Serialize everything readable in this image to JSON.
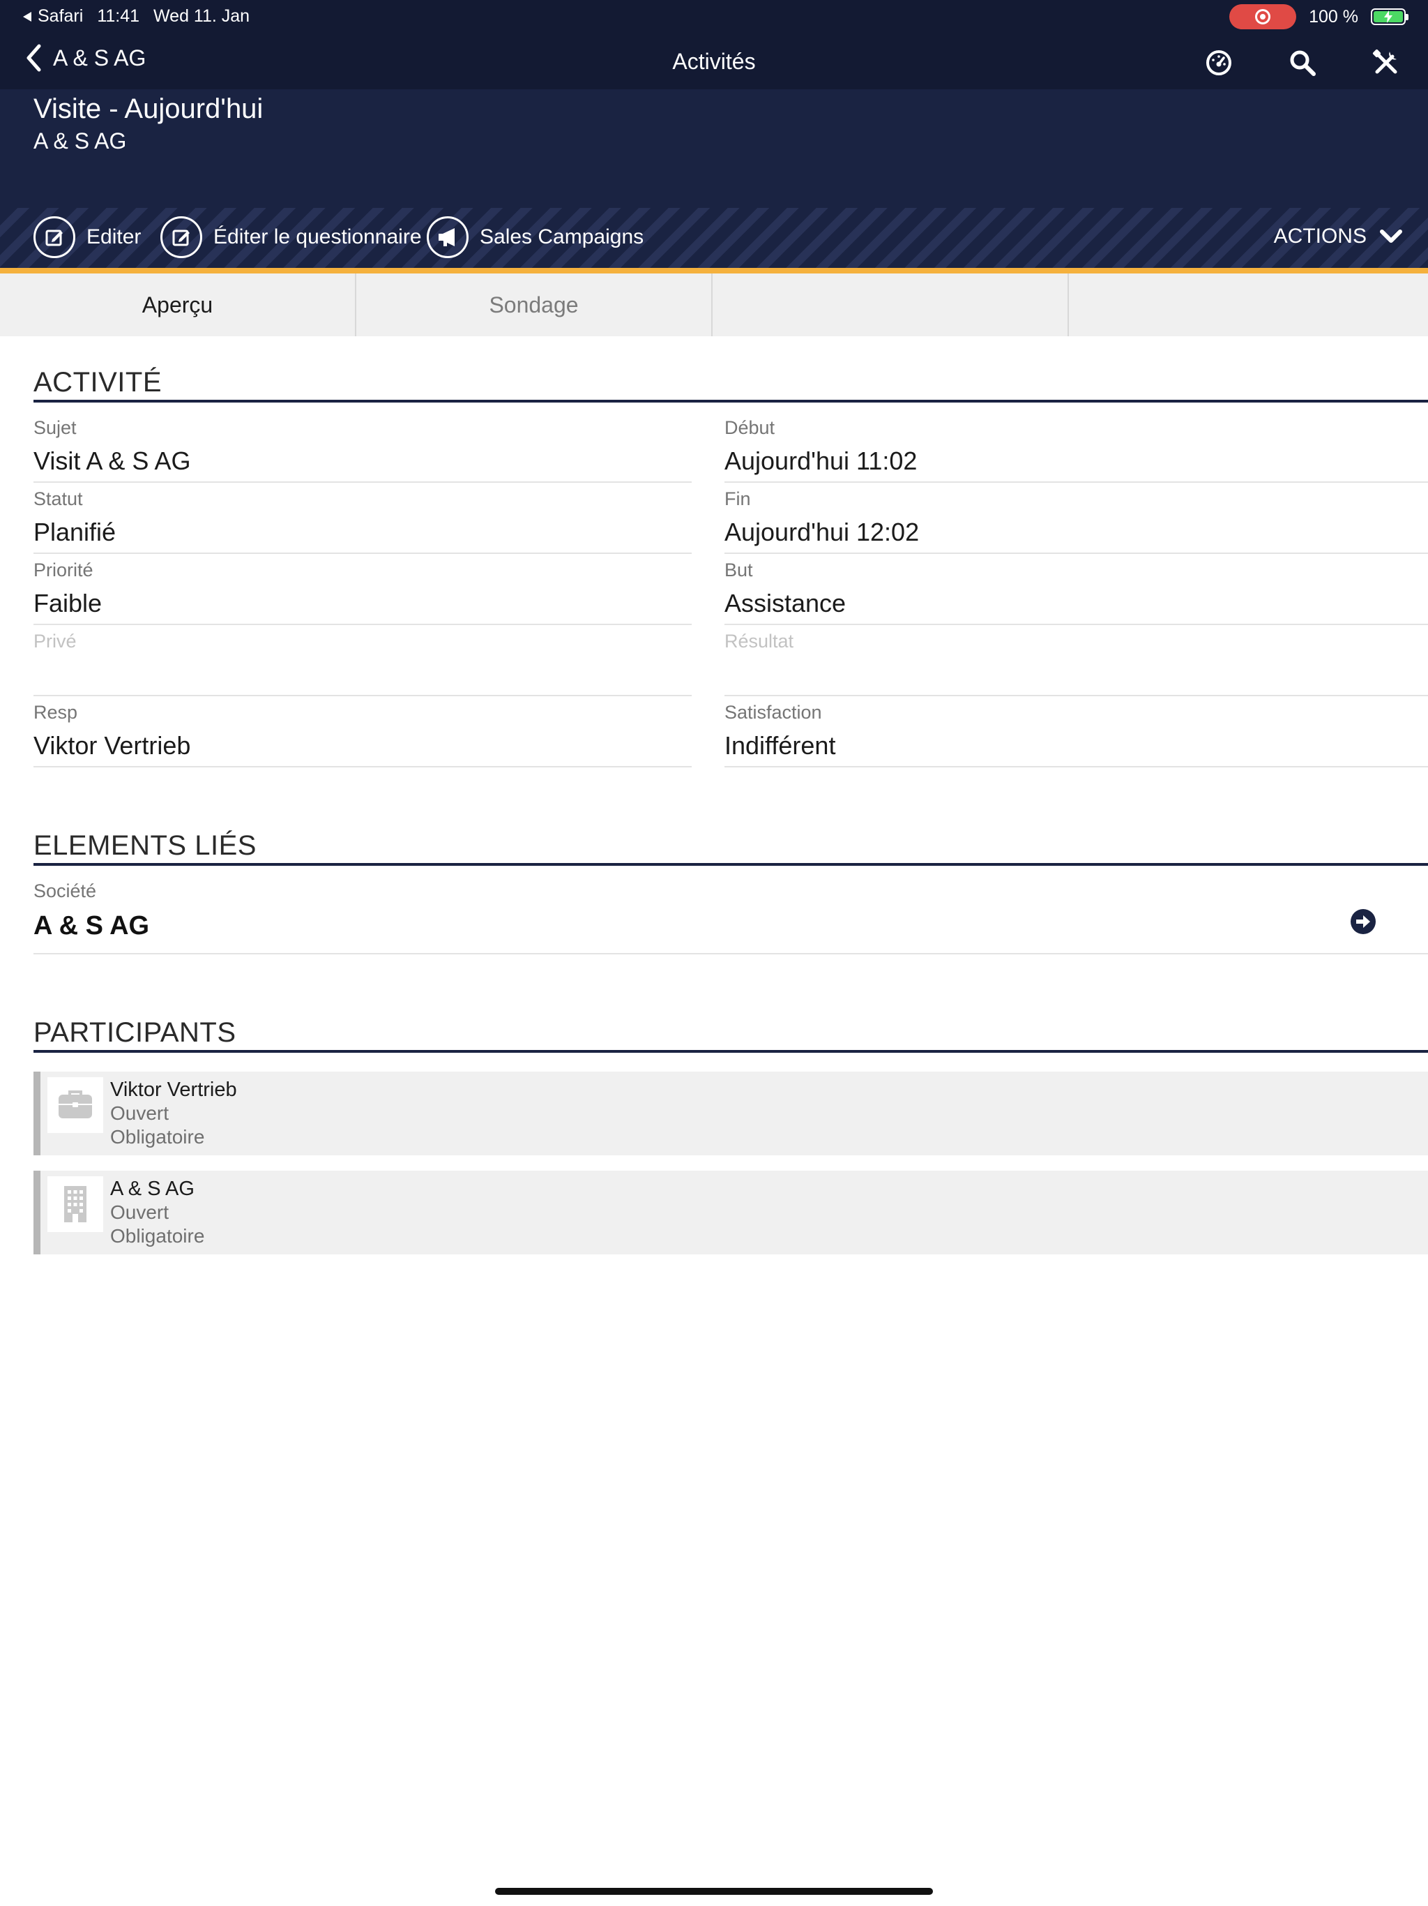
{
  "status_bar": {
    "back_app": "Safari",
    "time": "11:41",
    "date": "Wed 11. Jan",
    "battery": "100 %",
    "battery_level": 1.0
  },
  "nav": {
    "back_label": "A & S AG",
    "title": "Activités",
    "icons": [
      "dashboard-icon",
      "search-icon",
      "tools-icon"
    ]
  },
  "header": {
    "title": "Visite - Aujourd'hui",
    "subtitle": "A & S AG"
  },
  "actions": {
    "items": [
      {
        "label": "Editer",
        "icon": "edit-icon"
      },
      {
        "label": "Éditer le questionnaire",
        "icon": "edit-icon"
      },
      {
        "label": "Sales Campaigns",
        "icon": "megaphone-icon"
      }
    ],
    "menu_label": "ACTIONS"
  },
  "colors": {
    "navy": "#1a2342",
    "accent": "#f5b13d",
    "record": "#e04a45",
    "battery": "#4cd964"
  },
  "tabs": [
    {
      "label": "Aperçu",
      "active": true
    },
    {
      "label": "Sondage",
      "active": false
    },
    {
      "label": "",
      "active": false
    }
  ],
  "activity": {
    "section_title": "ACTIVITÉ",
    "left": [
      {
        "label": "Sujet",
        "value": "Visit A & S AG"
      },
      {
        "label": "Statut",
        "value": "Planifié"
      },
      {
        "label": "Priorité",
        "value": "Faible"
      },
      {
        "label": "Privé",
        "value": ""
      },
      {
        "label": "Resp",
        "value": "Viktor Vertrieb"
      }
    ],
    "right": [
      {
        "label": "Début",
        "value": "Aujourd'hui 11:02"
      },
      {
        "label": "Fin",
        "value": "Aujourd'hui 12:02"
      },
      {
        "label": "But",
        "value": "Assistance"
      },
      {
        "label": "Résultat",
        "value": ""
      },
      {
        "label": "Satisfaction",
        "value": "Indifférent"
      }
    ]
  },
  "linked": {
    "section_title": "ELEMENTS LIÉS",
    "label": "Société",
    "value": "A & S AG"
  },
  "participants": {
    "section_title": "PARTICIPANTS",
    "items": [
      {
        "name": "Viktor Vertrieb",
        "status": "Ouvert",
        "requirement": "Obligatoire",
        "icon": "briefcase-icon"
      },
      {
        "name": "A & S AG",
        "status": "Ouvert",
        "requirement": "Obligatoire",
        "icon": "building-icon"
      }
    ]
  }
}
